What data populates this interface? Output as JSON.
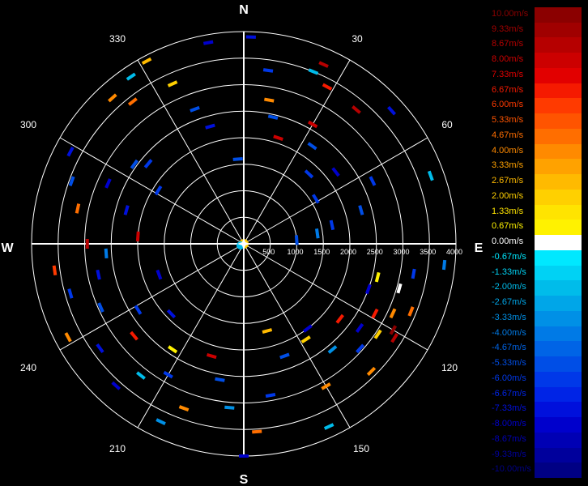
{
  "chart_data": {
    "type": "polar-scatter",
    "cardinals": [
      "N",
      "E",
      "S",
      "W"
    ],
    "angle_labels": [
      "30",
      "60",
      "120",
      "150",
      "210",
      "240",
      "300",
      "330"
    ],
    "angle_values": [
      30,
      60,
      120,
      150,
      210,
      240,
      300,
      330
    ],
    "range_labels": [
      "500",
      "1000",
      "1500",
      "2000",
      "2500",
      "3000",
      "3500",
      "4000"
    ],
    "range_values": [
      500,
      1000,
      1500,
      2000,
      2500,
      3000,
      3500,
      4000
    ],
    "r_max": 4000,
    "grid": true,
    "legend_position": "right",
    "legend": [
      {
        "label": "10.00m/s",
        "color": "#8b0000"
      },
      {
        "label": "9.33m/s",
        "color": "#a00000"
      },
      {
        "label": "8.67m/s",
        "color": "#b60000"
      },
      {
        "label": "8.00m/s",
        "color": "#cc0000"
      },
      {
        "label": "7.33m/s",
        "color": "#e20000"
      },
      {
        "label": "6.67m/s",
        "color": "#f51a00"
      },
      {
        "label": "6.00m/s",
        "color": "#ff3a00"
      },
      {
        "label": "5.33m/s",
        "color": "#ff5400"
      },
      {
        "label": "4.67m/s",
        "color": "#ff6e00"
      },
      {
        "label": "4.00m/s",
        "color": "#ff8a00"
      },
      {
        "label": "3.33m/s",
        "color": "#ffa200"
      },
      {
        "label": "2.67m/s",
        "color": "#ffba00"
      },
      {
        "label": "2.00m/s",
        "color": "#ffd000"
      },
      {
        "label": "1.33m/s",
        "color": "#ffe400"
      },
      {
        "label": "0.67m/s",
        "color": "#fff200"
      },
      {
        "label": "0.00m/s",
        "color": "#ffffff"
      },
      {
        "label": "-0.67m/s",
        "color": "#00e8ff"
      },
      {
        "label": "-1.33m/s",
        "color": "#00d2f4"
      },
      {
        "label": "-2.00m/s",
        "color": "#00bcea"
      },
      {
        "label": "-2.67m/s",
        "color": "#00a6e8"
      },
      {
        "label": "-3.33m/s",
        "color": "#0090e6"
      },
      {
        "label": "-4.00m/s",
        "color": "#007ae6"
      },
      {
        "label": "-4.67m/s",
        "color": "#0064e6"
      },
      {
        "label": "-5.33m/s",
        "color": "#004ee6"
      },
      {
        "label": "-6.00m/s",
        "color": "#0038e8"
      },
      {
        "label": "-6.67m/s",
        "color": "#0024e6"
      },
      {
        "label": "-7.33m/s",
        "color": "#0010dc"
      },
      {
        "label": "-8.00m/s",
        "color": "#0000cc"
      },
      {
        "label": "-8.67m/s",
        "color": "#0000b4"
      },
      {
        "label": "-9.33m/s",
        "color": "#00009c"
      },
      {
        "label": "-10.00m/s",
        "color": "#000084"
      }
    ],
    "points": [
      {
        "az": 2,
        "r": 3900,
        "v": -7
      },
      {
        "az": 8,
        "r": 3300,
        "v": -6
      },
      {
        "az": 10,
        "r": 2750,
        "v": 4
      },
      {
        "az": 13,
        "r": 2450,
        "v": -5
      },
      {
        "az": 18,
        "r": 2100,
        "v": 8
      },
      {
        "az": 22,
        "r": 3500,
        "v": -2
      },
      {
        "az": 24,
        "r": 3700,
        "v": 9
      },
      {
        "az": 28,
        "r": 3350,
        "v": 7
      },
      {
        "az": 30,
        "r": 2600,
        "v": 8
      },
      {
        "az": 35,
        "r": 2250,
        "v": -5
      },
      {
        "az": 40,
        "r": 3300,
        "v": 9
      },
      {
        "az": 43,
        "r": 1800,
        "v": -6
      },
      {
        "az": 48,
        "r": 3750,
        "v": -7
      },
      {
        "az": 52,
        "r": 2200,
        "v": -8
      },
      {
        "az": 58,
        "r": 1600,
        "v": -6
      },
      {
        "az": 64,
        "r": 2700,
        "v": -6
      },
      {
        "az": 70,
        "r": 3750,
        "v": -2
      },
      {
        "az": 74,
        "r": 2300,
        "v": -5
      },
      {
        "az": 78,
        "r": 1700,
        "v": -6
      },
      {
        "az": 82,
        "r": 1400,
        "v": -4
      },
      {
        "az": 86,
        "r": 1000,
        "v": -5
      },
      {
        "az": 96,
        "r": 3800,
        "v": -4
      },
      {
        "az": 100,
        "r": 3250,
        "v": -6
      },
      {
        "az": 104,
        "r": 2600,
        "v": 1
      },
      {
        "az": 106,
        "r": 3050,
        "v": 0
      },
      {
        "az": 110,
        "r": 2500,
        "v": -8
      },
      {
        "az": 112,
        "r": 3400,
        "v": 5
      },
      {
        "az": 115,
        "r": 3100,
        "v": 4
      },
      {
        "az": 118,
        "r": 2800,
        "v": 7
      },
      {
        "az": 120,
        "r": 3250,
        "v": 10
      },
      {
        "az": 122,
        "r": 3350,
        "v": 9
      },
      {
        "az": 124,
        "r": 3050,
        "v": 2
      },
      {
        "az": 126,
        "r": 2700,
        "v": -8
      },
      {
        "az": 128,
        "r": 2300,
        "v": 7
      },
      {
        "az": 132,
        "r": 2950,
        "v": -6
      },
      {
        "az": 135,
        "r": 3400,
        "v": 4
      },
      {
        "az": 140,
        "r": 2600,
        "v": -3
      },
      {
        "az": 143,
        "r": 2000,
        "v": -8
      },
      {
        "az": 147,
        "r": 2150,
        "v": 2
      },
      {
        "az": 150,
        "r": 3100,
        "v": 4
      },
      {
        "az": 155,
        "r": 3800,
        "v": -2
      },
      {
        "az": 160,
        "r": 2250,
        "v": -5
      },
      {
        "az": 165,
        "r": 1700,
        "v": 3
      },
      {
        "az": 170,
        "r": 2900,
        "v": -6
      },
      {
        "az": 176,
        "r": 3550,
        "v": 5
      },
      {
        "az": 180,
        "r": 4000,
        "v": -8
      },
      {
        "az": 185,
        "r": 3100,
        "v": -3
      },
      {
        "az": 190,
        "r": 2600,
        "v": -5
      },
      {
        "az": 196,
        "r": 2200,
        "v": 8
      },
      {
        "az": 200,
        "r": 3300,
        "v": 4
      },
      {
        "az": 205,
        "r": 3700,
        "v": -3
      },
      {
        "az": 210,
        "r": 2850,
        "v": -6
      },
      {
        "az": 214,
        "r": 2400,
        "v": 1
      },
      {
        "az": 218,
        "r": 3150,
        "v": -2
      },
      {
        "az": 222,
        "r": 3600,
        "v": -8
      },
      {
        "az": 226,
        "r": 1900,
        "v": -7
      },
      {
        "az": 230,
        "r": 2700,
        "v": 7
      },
      {
        "az": 234,
        "r": 3350,
        "v": -7
      },
      {
        "az": 238,
        "r": 2350,
        "v": -6
      },
      {
        "az": 242,
        "r": 3750,
        "v": 4
      },
      {
        "az": 246,
        "r": 2950,
        "v": -5
      },
      {
        "az": 250,
        "r": 1700,
        "v": -8
      },
      {
        "az": 254,
        "r": 3400,
        "v": -6
      },
      {
        "az": 258,
        "r": 2800,
        "v": -7
      },
      {
        "az": 262,
        "r": 3600,
        "v": 6
      },
      {
        "az": 266,
        "r": 2600,
        "v": -4
      },
      {
        "az": 270,
        "r": 2950,
        "v": 9
      },
      {
        "az": 274,
        "r": 2000,
        "v": 8
      },
      {
        "az": 282,
        "r": 3200,
        "v": 5
      },
      {
        "az": 286,
        "r": 2300,
        "v": -7
      },
      {
        "az": 290,
        "r": 3450,
        "v": -5
      },
      {
        "az": 294,
        "r": 2800,
        "v": -8
      },
      {
        "az": 298,
        "r": 3700,
        "v": -7
      },
      {
        "az": 302,
        "r": 1900,
        "v": -6
      },
      {
        "az": 306,
        "r": 2550,
        "v": -5
      },
      {
        "az": 310,
        "r": 2350,
        "v": -6
      },
      {
        "az": 318,
        "r": 3700,
        "v": 4
      },
      {
        "az": 322,
        "r": 3400,
        "v": 5
      },
      {
        "az": 326,
        "r": 3800,
        "v": -2
      },
      {
        "az": 332,
        "r": 3900,
        "v": 3
      },
      {
        "az": 336,
        "r": 3300,
        "v": 2
      },
      {
        "az": 340,
        "r": 2700,
        "v": -5
      },
      {
        "az": 344,
        "r": 2300,
        "v": -7
      },
      {
        "az": 350,
        "r": 3850,
        "v": -8
      },
      {
        "az": 356,
        "r": 1600,
        "v": -5
      }
    ]
  }
}
